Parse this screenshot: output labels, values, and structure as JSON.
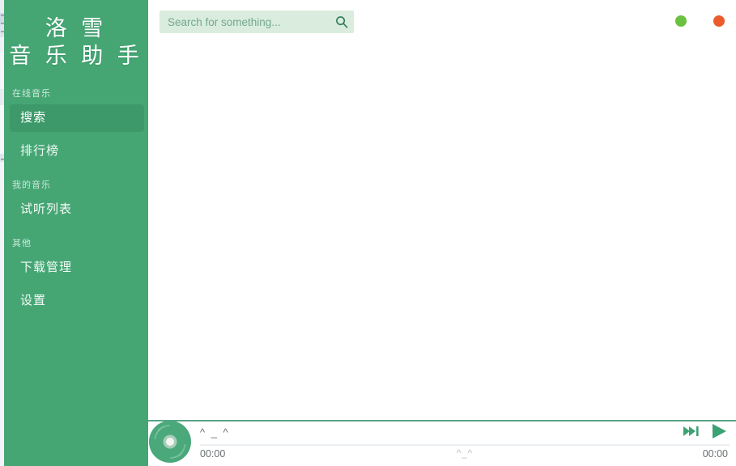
{
  "app": {
    "logo_line1": "洛 雪",
    "logo_line2": "音 乐 助 手",
    "accent_color": "#45a674",
    "accent_active_color": "#3d996a",
    "search_bg_color": "#d9ecde"
  },
  "search": {
    "placeholder": "Search for something...",
    "value": "",
    "icon": "search-icon"
  },
  "window_controls": {
    "minimize": {
      "name": "minimize-button",
      "color": "#6cc03f"
    },
    "close": {
      "name": "close-button",
      "color": "#ec5b2b"
    }
  },
  "sidebar": {
    "sections": [
      {
        "label": "在线音乐",
        "items": [
          {
            "label": "搜索",
            "active": true
          },
          {
            "label": "排行榜",
            "active": false
          }
        ]
      },
      {
        "label": "我的音乐",
        "items": [
          {
            "label": "试听列表",
            "active": false
          }
        ]
      },
      {
        "label": "其他",
        "items": [
          {
            "label": "下载管理",
            "active": false
          },
          {
            "label": "设置",
            "active": false
          }
        ]
      }
    ]
  },
  "player": {
    "album_art_icon": "vinyl-disc-icon",
    "song_title": "^ _ ^",
    "lyric_text": "^_^",
    "current_time": "00:00",
    "total_time": "00:00",
    "progress_percent": 0,
    "controls": [
      {
        "name": "next-track-button",
        "icon": "skip-next-icon"
      },
      {
        "name": "play-button",
        "icon": "play-icon"
      }
    ]
  }
}
